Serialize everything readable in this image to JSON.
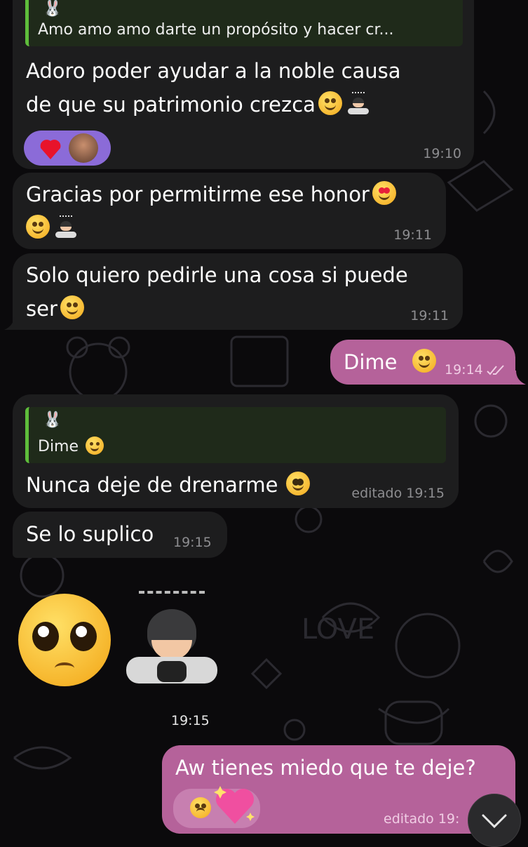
{
  "messages": [
    {
      "id": "m1",
      "reply_text": "Amo amo amo darte un propósito y hacer cr...",
      "line1": "Adoro poder ayudar a la noble causa",
      "line2": "de que su patrimonio crezca",
      "time": "19:10"
    },
    {
      "id": "m2",
      "line1": "Gracias por permitirme ese honor",
      "time": "19:11"
    },
    {
      "id": "m3",
      "line1": "Solo quiero pedirle una cosa si puede",
      "line2": "ser",
      "time": "19:11"
    },
    {
      "id": "m4",
      "line1": "Dime",
      "time": "19:14"
    },
    {
      "id": "m5",
      "reply_text": "Dime",
      "line1": "Nunca deje de drenarme",
      "time": "editado 19:15"
    },
    {
      "id": "m6",
      "line1": "Se lo suplico",
      "time": "19:15"
    },
    {
      "id": "m7",
      "time": "19:15"
    },
    {
      "id": "m8",
      "line1": "Aw tienes miedo que te deje?",
      "time": "editado 19:"
    }
  ],
  "colors": {
    "incoming": "#1d1d1e",
    "outgoing": "#b5629a",
    "reply_bar": "#5ebd3b",
    "reaction": "#8b6bd8"
  },
  "icons": {
    "reply_sender": "rabbit-icon",
    "read_receipt": "double-check-icon",
    "scroll_down": "chevron-down-icon"
  }
}
